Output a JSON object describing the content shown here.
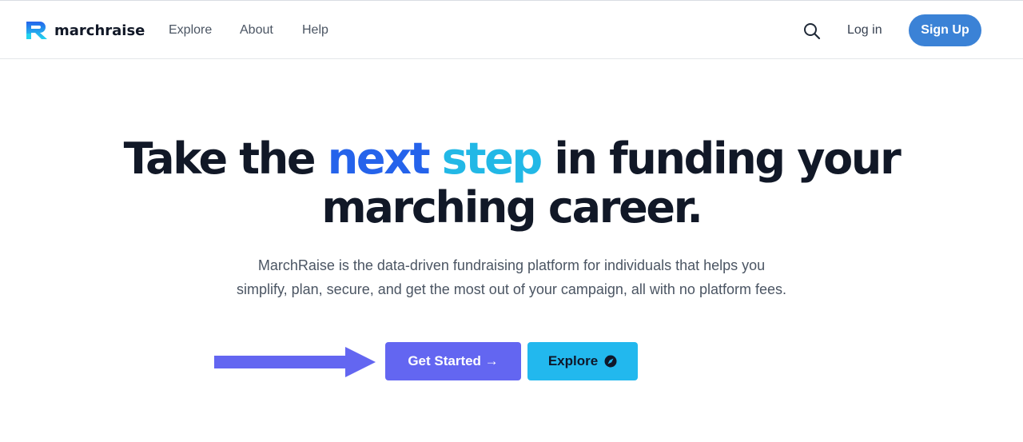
{
  "brand": {
    "name": "marchraise",
    "colors": {
      "primary": "#3b82d6",
      "gradient_start": "#2563eb",
      "gradient_end": "#22d3ee"
    }
  },
  "nav": {
    "links": [
      {
        "label": "Explore"
      },
      {
        "label": "About"
      },
      {
        "label": "Help"
      }
    ],
    "search_icon": "search-icon",
    "login_label": "Log in",
    "signup_label": "Sign Up"
  },
  "hero": {
    "title_before": "Take the ",
    "title_highlight_1": "next",
    "title_space": " ",
    "title_highlight_2": "step",
    "title_after_line1": " in funding your",
    "title_line2": "marching career.",
    "subtitle": "MarchRaise is the data-driven fundraising platform for individuals that helps you simplify, plan, secure, and get the most out of your campaign, all with no platform fees.",
    "cta_primary": "Get Started →",
    "cta_secondary": "Explore",
    "cta_secondary_icon": "compass-icon",
    "annotation_icon": "arrow-right-icon",
    "colors": {
      "primary_btn": "#6366f1",
      "secondary_btn": "#22b8ee",
      "arrow": "#6366f1"
    }
  }
}
